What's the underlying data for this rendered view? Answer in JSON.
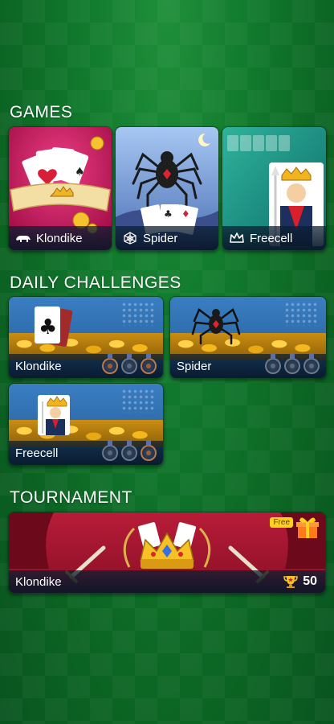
{
  "sections": {
    "games_title": "GAMES",
    "daily_title": "DAILY CHALLENGES",
    "tournament_title": "TOURNAMENT"
  },
  "games": [
    {
      "label": "Klondike",
      "icon": "polar-bear-icon"
    },
    {
      "label": "Spider",
      "icon": "spider-web-icon"
    },
    {
      "label": "Freecell",
      "icon": "crown-icon"
    }
  ],
  "daily": [
    {
      "label": "Klondike"
    },
    {
      "label": "Spider"
    },
    {
      "label": "Freecell"
    }
  ],
  "tournament": {
    "label": "Klondike",
    "free_badge": "Free",
    "trophy_count": "50"
  },
  "colors": {
    "background": "#117a2d",
    "klondike_card": "#c8195a",
    "spider_card": "#7da3df",
    "freecell_card": "#1a8f7e",
    "daily_card": "#2e6fae",
    "tournament_card": "#9e1530"
  }
}
